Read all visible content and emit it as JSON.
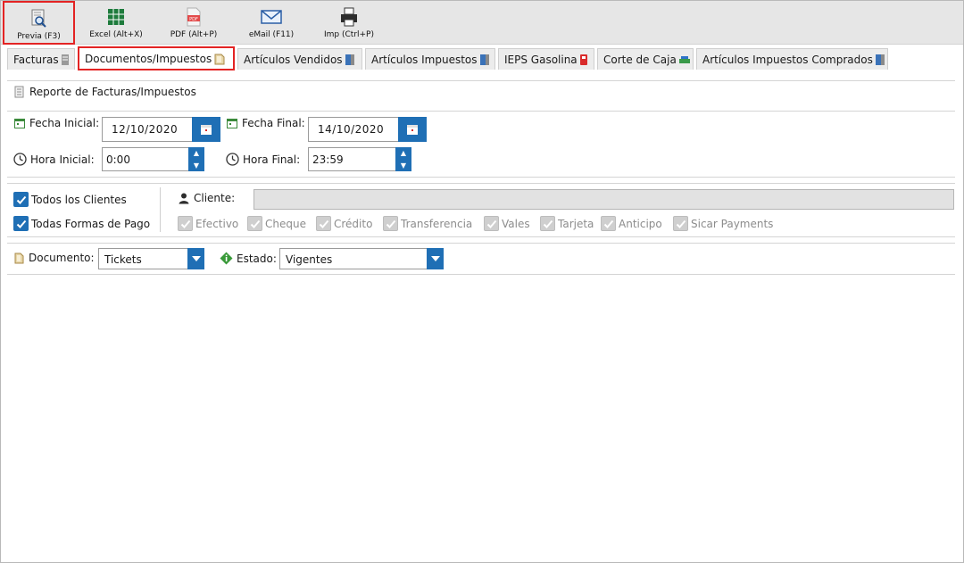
{
  "toolbar": {
    "buttons": [
      {
        "label": "Previa (F3)",
        "icon": "preview-search-icon"
      },
      {
        "label": "Excel (Alt+X)",
        "icon": "excel-icon"
      },
      {
        "label": "PDF (Alt+P)",
        "icon": "pdf-icon"
      },
      {
        "label": "eMail (F11)",
        "icon": "email-icon"
      },
      {
        "label": "Imp (Ctrl+P)",
        "icon": "printer-icon"
      }
    ]
  },
  "tabs": [
    {
      "label": "Facturas"
    },
    {
      "label": "Documentos/Impuestos"
    },
    {
      "label": "Artículos Vendidos"
    },
    {
      "label": "Artículos Impuestos"
    },
    {
      "label": "IEPS Gasolina"
    },
    {
      "label": "Corte de Caja"
    },
    {
      "label": "Artículos Impuestos Comprados"
    }
  ],
  "section_title": "Reporte de Facturas/Impuestos",
  "dates": {
    "start_label": "Fecha Inicial:",
    "start_value": "12/10/2020",
    "end_label": "Fecha Final:",
    "end_value": "14/10/2020"
  },
  "times": {
    "start_label": "Hora Inicial:",
    "start_value": "0:00",
    "end_label": "Hora Final:",
    "end_value": "23:59"
  },
  "filters": {
    "all_clients": "Todos los Clientes",
    "all_payments": "Todas Formas de Pago",
    "client_label": "Cliente:",
    "payment_methods": [
      "Efectivo",
      "Cheque",
      "Crédito",
      "Transferencia",
      "Vales",
      "Tarjeta",
      "Anticipo",
      "Sicar Payments"
    ]
  },
  "document": {
    "label": "Documento:",
    "value": "Tickets"
  },
  "status": {
    "label": "Estado:",
    "value": "Vigentes"
  },
  "colors": {
    "accent": "#1f6fb5",
    "highlight": "#e32323"
  }
}
